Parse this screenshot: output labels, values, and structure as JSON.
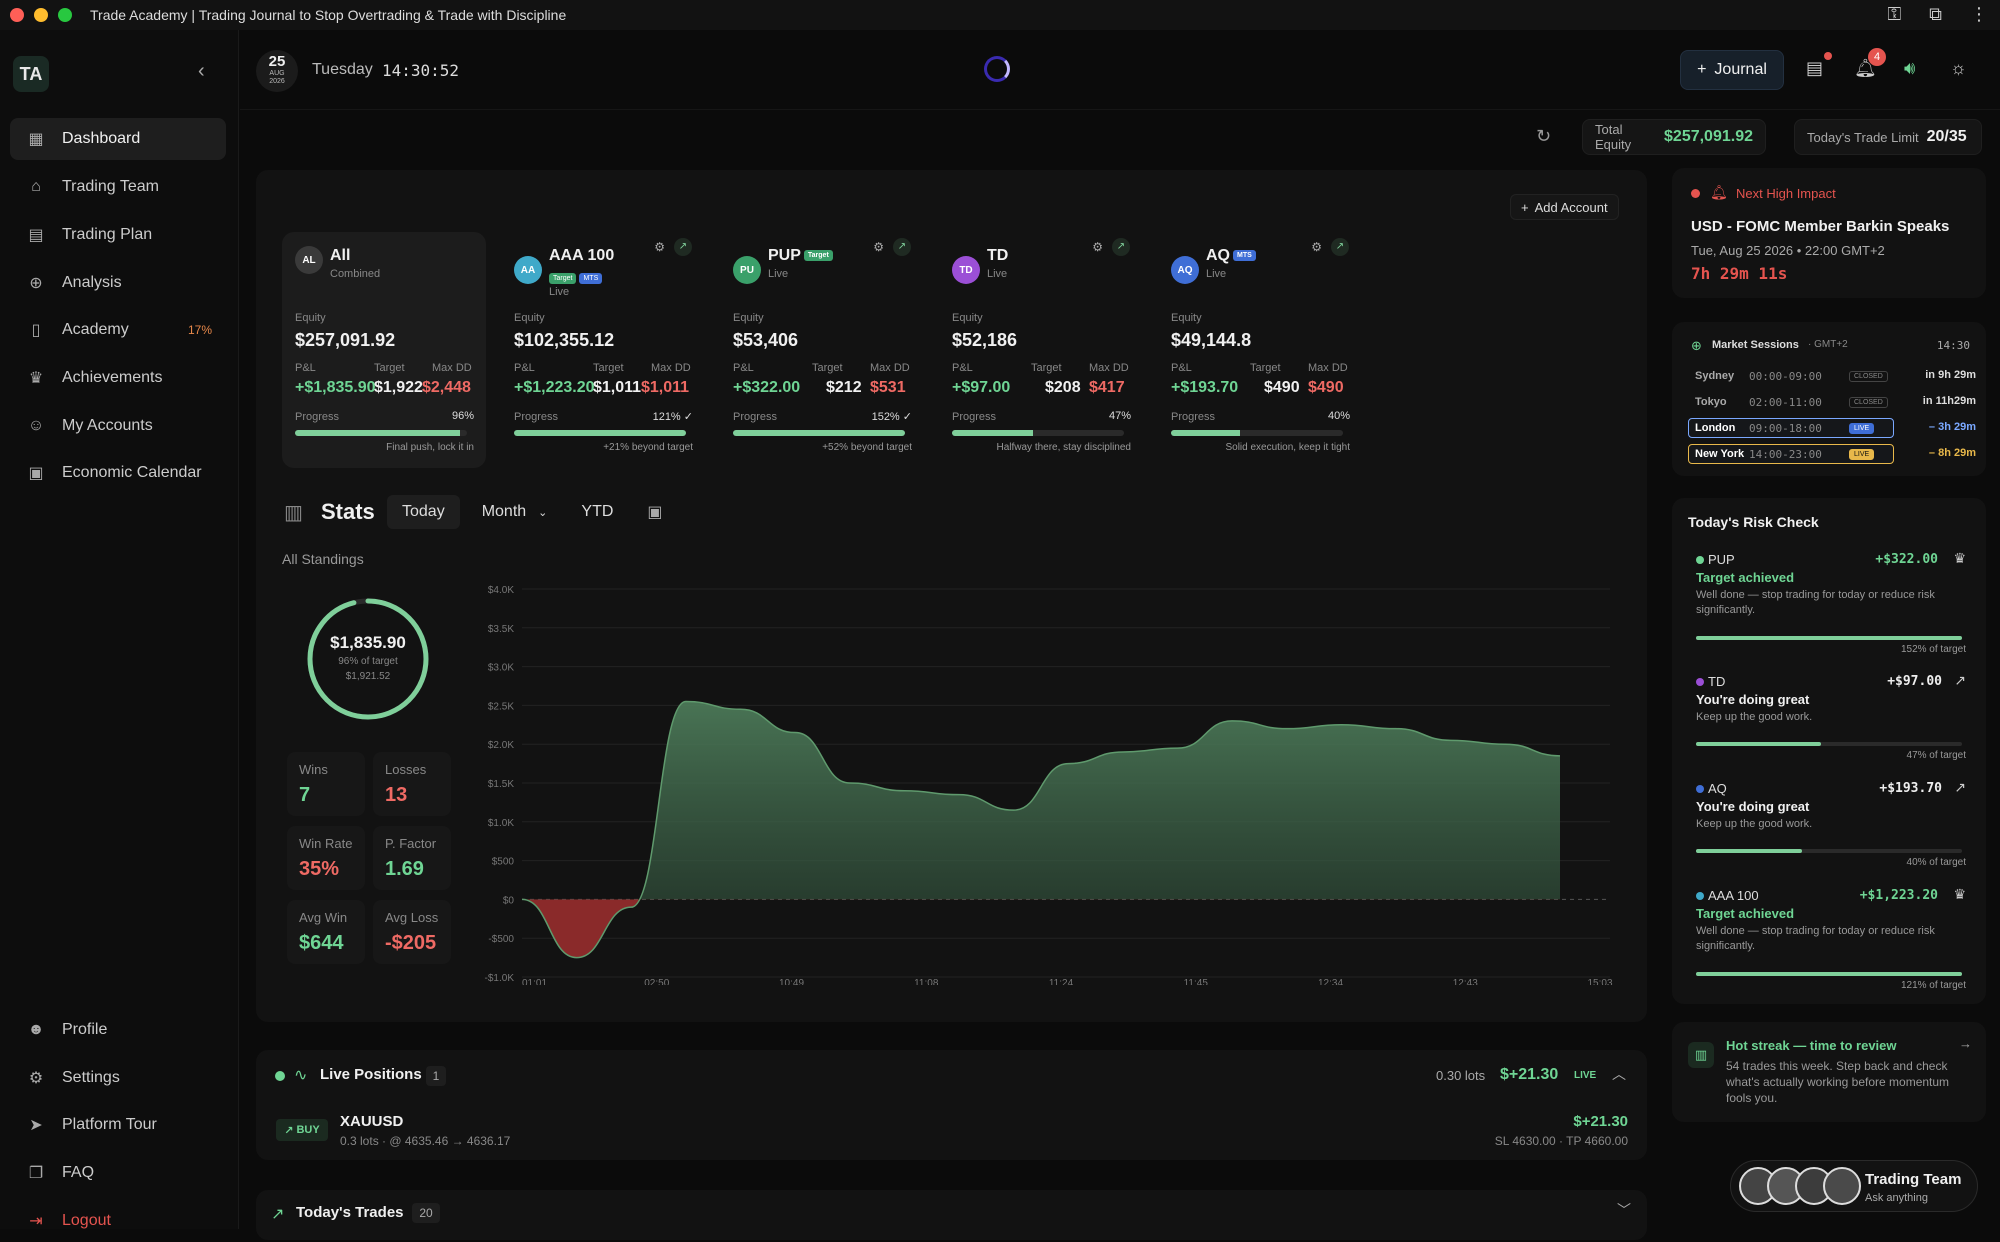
{
  "window": {
    "title": "Trade Academy | Trading Journal to Stop Overtrading & Trade with Discipline"
  },
  "colors": {
    "accent_green": "#6fd594",
    "loss_red": "#ef6a64",
    "academy_orange": "#e8884a",
    "bg": "#0b0b0b"
  },
  "sidebar": {
    "logo": "TA",
    "items": [
      {
        "label": "Dashboard",
        "icon": "grid-icon"
      },
      {
        "label": "Trading Team",
        "icon": "briefcase-icon"
      },
      {
        "label": "Trading Plan",
        "icon": "clipboard-icon"
      },
      {
        "label": "Analysis",
        "icon": "globe-icon"
      },
      {
        "label": "Academy",
        "icon": "book-icon",
        "badge": "17%"
      },
      {
        "label": "Achievements",
        "icon": "trophy-icon"
      },
      {
        "label": "My Accounts",
        "icon": "users-icon"
      },
      {
        "label": "Economic Calendar",
        "icon": "calendar-icon"
      }
    ],
    "bottom_items": [
      {
        "label": "Profile",
        "icon": "user-icon"
      },
      {
        "label": "Settings",
        "icon": "gear-icon"
      },
      {
        "label": "Platform Tour",
        "icon": "send-icon"
      },
      {
        "label": "FAQ",
        "icon": "book-open-icon"
      },
      {
        "label": "Logout",
        "icon": "logout-icon"
      }
    ]
  },
  "header": {
    "date_day": "25",
    "date_month": "AUG",
    "date_year": "2026",
    "weekday": "Tuesday",
    "clock": "14:30:52",
    "journal_label": "Journal",
    "notifications_count": "4"
  },
  "summary": {
    "total_equity_label": "Total Equity",
    "total_equity": "$257,091.92",
    "trade_limit_label": "Today's Trade Limit",
    "trade_limit": "20/35"
  },
  "accounts": {
    "add_label": "Add Account",
    "labels": {
      "equity": "Equity",
      "pnl": "P&L",
      "target": "Target",
      "maxdd": "Max DD",
      "progress": "Progress"
    },
    "cards": [
      {
        "initials": "AL",
        "name": "All",
        "sub": "Combined",
        "equity": "$257,091.92",
        "pnl": "+$1,835.90",
        "target": "$1,922",
        "maxdd": "$2,448",
        "progress": "96%",
        "progress_value": 0.96,
        "note": "Final push, lock it in",
        "avatar_color": "#3a3a3a"
      },
      {
        "initials": "AA",
        "name": "AAA 100",
        "sub": "Live",
        "tags": [
          "Target",
          "MTS"
        ],
        "equity": "$102,355.12",
        "pnl": "+$1,223.20",
        "target": "$1,011",
        "maxdd": "$1,011",
        "progress": "121% ✓",
        "progress_value": 1.0,
        "note": "+21% beyond target",
        "avatar_color": "#3fa9c9"
      },
      {
        "initials": "PU",
        "name": "PUP",
        "sub": "Live",
        "tags": [
          "Target"
        ],
        "equity": "$53,406",
        "pnl": "+$322.00",
        "target": "$212",
        "maxdd": "$531",
        "progress": "152% ✓",
        "progress_value": 1.0,
        "note": "+52% beyond target",
        "avatar_color": "#3aa06a"
      },
      {
        "initials": "TD",
        "name": "TD",
        "sub": "Live",
        "equity": "$52,186",
        "pnl": "+$97.00",
        "target": "$208",
        "maxdd": "$417",
        "progress": "47%",
        "progress_value": 0.47,
        "note": "Halfway there, stay disciplined",
        "avatar_color": "#9b4fd6"
      },
      {
        "initials": "AQ",
        "name": "AQ",
        "sub": "Live",
        "tags": [
          "MTS"
        ],
        "equity": "$49,144.8",
        "pnl": "+$193.70",
        "target": "$490",
        "maxdd": "$490",
        "progress": "40%",
        "progress_value": 0.4,
        "note": "Solid execution, keep it tight",
        "avatar_color": "#3f6ed6"
      }
    ]
  },
  "stats": {
    "title": "Stats",
    "tabs": [
      "Today",
      "Month",
      "YTD"
    ],
    "standings_label": "All Standings",
    "ring_value": "$1,835.90",
    "ring_sub": "96% of target",
    "ring_target": "$1,921.52",
    "ring_progress": 0.96,
    "boxes": [
      {
        "label": "Wins",
        "value": "7",
        "tone": "green"
      },
      {
        "label": "Losses",
        "value": "13",
        "tone": "red"
      },
      {
        "label": "Win Rate",
        "value": "35%",
        "tone": "red"
      },
      {
        "label": "P. Factor",
        "value": "1.69",
        "tone": "green"
      },
      {
        "label": "Avg Win",
        "value": "$644",
        "tone": "green"
      },
      {
        "label": "Avg Loss",
        "value": "-$205",
        "tone": "red"
      }
    ]
  },
  "chart_data": {
    "type": "area",
    "x": [
      "01:01",
      "01:30",
      "02:00",
      "02:30",
      "03:30",
      "04:10",
      "04:49",
      "06:00",
      "07:00",
      "07:30",
      "08:30",
      "11:08",
      "11:24",
      "11:30",
      "11:45",
      "12:00",
      "12:34",
      "12:43",
      "14:00",
      "15:03"
    ],
    "values": [
      0,
      -750,
      -100,
      2550,
      2450,
      2150,
      1500,
      1400,
      1350,
      1150,
      1750,
      1900,
      1950,
      2300,
      2200,
      2250,
      2200,
      2050,
      2000,
      1850
    ],
    "x_ticks": [
      "01:01",
      "02:50",
      "10:49",
      "11:08",
      "11:24",
      "11:45",
      "12:34",
      "12:43",
      "15:03"
    ],
    "y_ticks": [
      "$4.0K",
      "$3.5K",
      "$3.0K",
      "$2.5K",
      "$2.0K",
      "$1.5K",
      "$1.0K",
      "$500",
      "$0",
      "-$500",
      "-$1.0K"
    ],
    "ylim": [
      -1000,
      4000
    ],
    "grid": true
  },
  "positions": {
    "title": "Live Positions",
    "count": "1",
    "lots": "0.30 lots",
    "pnl": "$+21.30",
    "live": "LIVE",
    "items": [
      {
        "side": "BUY",
        "symbol": "XAUUSD",
        "detail": "0.3 lots · @ 4635.46 → 4636.17",
        "pnl": "$+21.30",
        "sltp": "SL 4630.00 · TP 4660.00"
      }
    ]
  },
  "trades": {
    "title": "Today's Trades",
    "count": "20"
  },
  "impact": {
    "label": "Next High Impact",
    "title": "USD - FOMC Member Barkin Speaks",
    "when": "Tue, Aug 25 2026 • 22:00 GMT+2",
    "countdown": "7h 29m 11s"
  },
  "sessions": {
    "title": "Market Sessions",
    "tz": "· GMT+2",
    "now": "14:30",
    "rows": [
      {
        "name": "Sydney",
        "hours": "00:00-09:00",
        "status": "CLOSED",
        "in": "in 9h 29m"
      },
      {
        "name": "Tokyo",
        "hours": "02:00-11:00",
        "status": "CLOSED",
        "in": "in 11h29m"
      },
      {
        "name": "London",
        "hours": "09:00-18:00",
        "status": "LIVE",
        "in": "– 3h 29m"
      },
      {
        "name": "New York",
        "hours": "14:00-23:00",
        "status": "LIVE",
        "in": "– 8h 29m"
      }
    ]
  },
  "risk": {
    "title": "Today's Risk Check",
    "items": [
      {
        "name": "PUP",
        "amount": "+$322.00",
        "headline": "Target achieved",
        "desc": "Well done — stop trading for today or reduce risk significantly.",
        "pct": "152% of target",
        "fill": 1.0,
        "color": "#6fd594",
        "icon": "trophy-icon"
      },
      {
        "name": "TD",
        "amount": "+$97.00",
        "headline": "You're doing great",
        "desc": "Keep up the good work.",
        "pct": "47% of target",
        "fill": 0.47,
        "color": "#9b4fd6",
        "icon": "trend-up-icon"
      },
      {
        "name": "AQ",
        "amount": "+$193.70",
        "headline": "You're doing great",
        "desc": "Keep up the good work.",
        "pct": "40% of target",
        "fill": 0.4,
        "color": "#3f6ed6",
        "icon": "trend-up-icon"
      },
      {
        "name": "AAA 100",
        "amount": "+$1,223.20",
        "headline": "Target achieved",
        "desc": "Well done — stop trading for today or reduce risk significantly.",
        "pct": "121% of target",
        "fill": 1.0,
        "color": "#3fa9c9",
        "icon": "trophy-icon"
      }
    ]
  },
  "streak": {
    "title": "Hot streak — time to review",
    "desc": "54 trades this week. Step back and check what's actually working before momentum fools you."
  },
  "team_chip": {
    "title": "Trading Team",
    "sub": "Ask anything"
  }
}
